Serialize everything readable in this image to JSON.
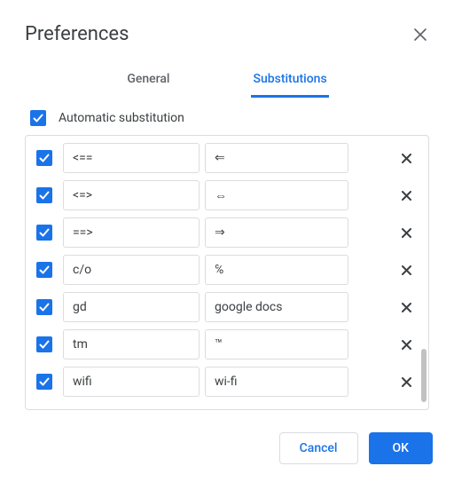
{
  "dialog": {
    "title": "Preferences",
    "tabs": {
      "general": "General",
      "substitutions": "Substitutions",
      "active": "substitutions"
    },
    "auto_substitution_label": "Automatic substitution",
    "auto_substitution_checked": true,
    "rows": [
      {
        "checked": true,
        "replace": "<==",
        "with": "⇐"
      },
      {
        "checked": true,
        "replace": "<=>",
        "with": "⇔"
      },
      {
        "checked": true,
        "replace": "==>",
        "with": "⇒"
      },
      {
        "checked": true,
        "replace": "c/o",
        "with": "℅"
      },
      {
        "checked": true,
        "replace": "gd",
        "with": "google docs"
      },
      {
        "checked": true,
        "replace": "tm",
        "with": "™"
      },
      {
        "checked": true,
        "replace": "wifi",
        "with": "wi-fi"
      }
    ],
    "buttons": {
      "cancel": "Cancel",
      "ok": "OK"
    }
  }
}
